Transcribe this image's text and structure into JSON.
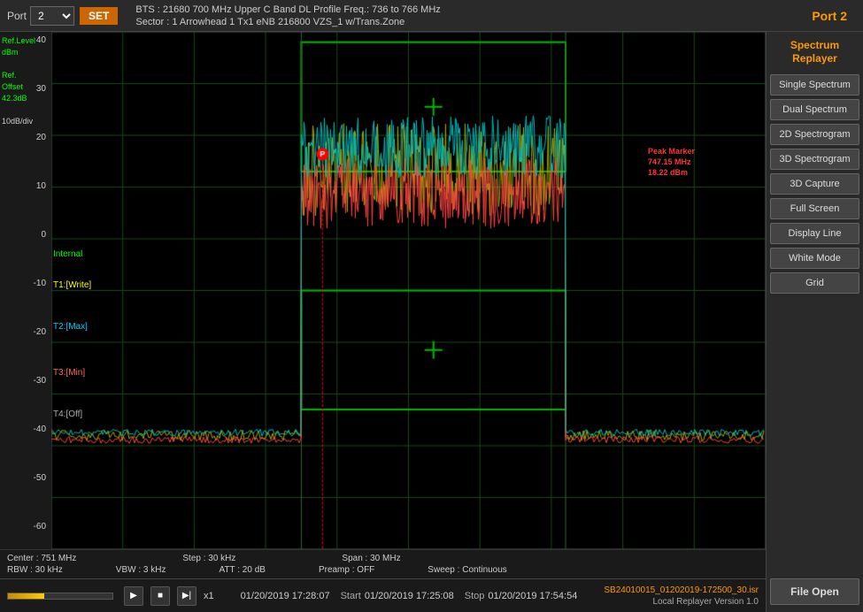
{
  "topbar": {
    "port_label": "Port",
    "port_value": "2",
    "set_label": "SET",
    "bts_line1": "BTS : 21680   700 MHz Upper C Band DL     Profile Freq.: 736 to 766 MHz",
    "bts_line2": "Sector : 1      Arrowhead 1 Tx1 eNB 216800 VZS_1 w/Trans.Zone",
    "port_right": "Port 2"
  },
  "yaxis": {
    "labels": [
      "40",
      "30",
      "20",
      "10",
      "0",
      "-10",
      "-20",
      "-30",
      "-40",
      "-50",
      "-60"
    ],
    "ref_level": "Ref.Level",
    "dbm": "dBm",
    "ref_offset": "Ref.",
    "offset_label": "Offset",
    "offset_value": "42.3dB",
    "scale": "10dB/div"
  },
  "trace_labels": {
    "t1": "T1:[Write]",
    "t2": "T2:[Max]",
    "t3": "T3:[Min]",
    "t4": "T4:[Off]",
    "internal": "Internal"
  },
  "peak_marker": {
    "label": "Peak Marker",
    "freq": "747.15 MHz",
    "level": "18.22 dBm"
  },
  "bottom_status": {
    "row1": [
      {
        "label": "Center : ",
        "value": "751 MHz"
      },
      {
        "label": "Step : ",
        "value": "30 kHz"
      },
      {
        "label": "Span : ",
        "value": "30 MHz"
      }
    ],
    "row2": [
      {
        "label": "RBW : ",
        "value": "30 kHz"
      },
      {
        "label": "VBW : ",
        "value": "3 kHz"
      },
      {
        "label": "ATT : ",
        "value": "20 dB"
      },
      {
        "label": "Preamp : ",
        "value": "OFF"
      },
      {
        "label": "Sweep : ",
        "value": "Continuous"
      }
    ]
  },
  "transport": {
    "speed": "x1",
    "date_time": "01/20/2019 17:28:07",
    "start_label": "Start",
    "start_time": "01/20/2019 17:25:08",
    "stop_label": "Stop",
    "stop_time": "01/20/2019 17:54:54"
  },
  "file_info": {
    "filename": "SB24010015_01202019-172500_30.isr",
    "version": "Local Replayer Version 1.0"
  },
  "sidebar": {
    "title": "Spectrum\nReplayer",
    "buttons": [
      "Single Spectrum",
      "Dual Spectrum",
      "2D Spectrogram",
      "3D Spectrogram",
      "3D Capture",
      "Full Screen",
      "Display Line",
      "White Mode",
      "Grid"
    ],
    "file_open": "File Open"
  }
}
